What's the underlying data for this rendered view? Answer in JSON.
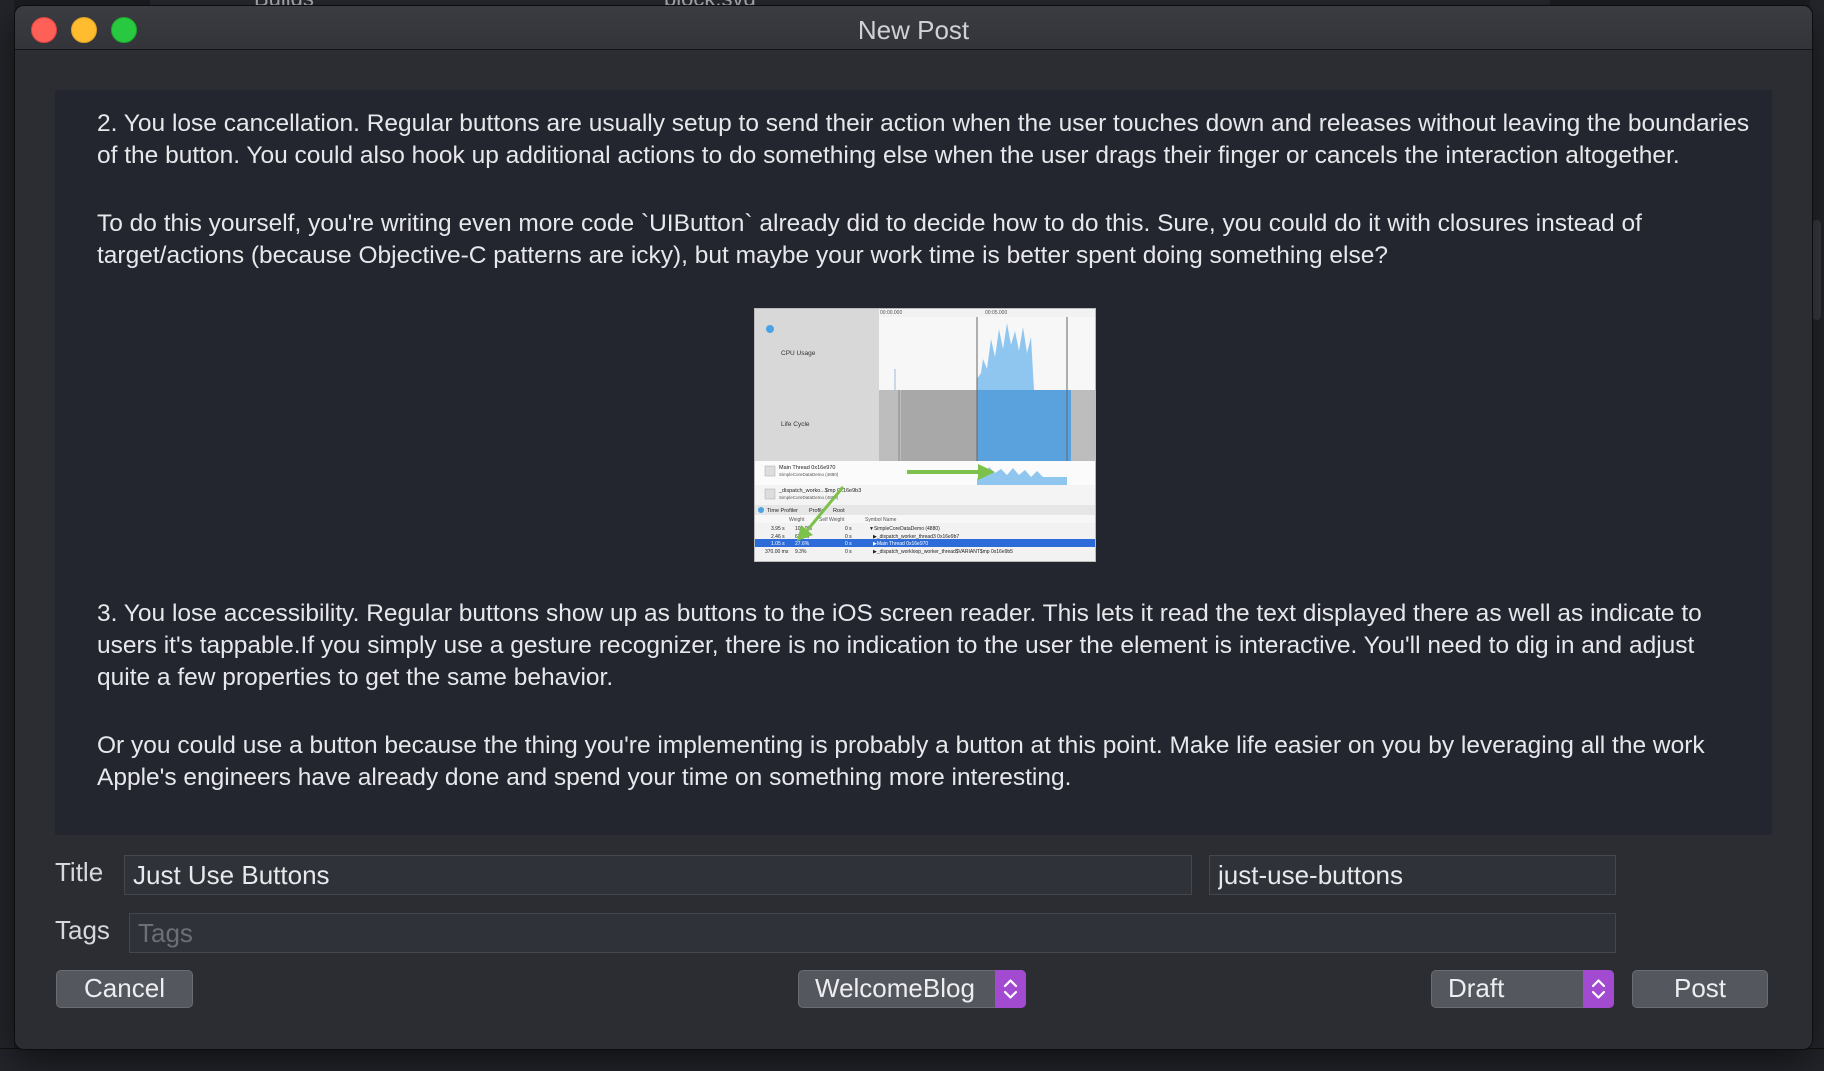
{
  "window": {
    "title": "New Post"
  },
  "background": {
    "ghost_texts": [
      "Builds",
      "block.svg"
    ]
  },
  "editor": {
    "paragraphs": [
      "2. You lose cancellation. Regular buttons are usually setup to send their action when the user touches down and releases without leaving the boundaries of the button. You could also hook up additional actions to do something else when the user drags their finger or cancels the interaction altogether.",
      "To do this yourself, you're writing even more code `UIButton` already did to decide how to do this. Sure, you could do it with closures instead of target/actions (because Objective-C patterns are icky), but maybe your work time is better spent doing something else?",
      "3. You lose accessibility. Regular buttons show up as buttons to the iOS screen reader. This lets it read the text displayed there as well as indicate to users it's tappable.If you simply use a gesture recognizer, there is no indication to the user the element is interactive. You'll need to dig in and adjust quite a few properties to get the same behavior.",
      "Or you could use a button because the thing you're implementing is probably a button at this point. Make life easier on you by leveraging all the work Apple's engineers have already done and spend your time on something more interesting."
    ],
    "figure": {
      "labels": {
        "cpu_usage": "CPU Usage",
        "life_cycle": "Life Cycle",
        "main_thread": "Main Thread 0x16e970",
        "main_thread_sub": "SimpleCoreDataDemo (4880)",
        "dispatch_worker": "_dispatch_worko...$mp 0x16e9b3",
        "dispatch_worker_sub": "SimpleCoreDataDemo (4880)",
        "time_profiler": "Time Profiler",
        "profile": "Profile",
        "root": "Root",
        "col_weight": "Weight",
        "col_self_weight": "Self Weight",
        "col_symbol": "Symbol Name",
        "time_start": "00:00.000",
        "time_mid": "00:05.000"
      },
      "rows": [
        {
          "weight": "3.95 s",
          "pct": "100.0%",
          "self": "0 s",
          "symbol": "▼SimpleCoreDataDemo (4880)"
        },
        {
          "weight": "2.46 s",
          "pct": "62.3%",
          "self": "0 s",
          "symbol": "▶_dispatch_worker_thread3 0x16e9b7"
        },
        {
          "weight": "1.05 s",
          "pct": "27.6%",
          "self": "0 s",
          "symbol": "▶Main Thread 0x16e970"
        },
        {
          "weight": "370.00 ms",
          "pct": "9.3%",
          "self": "0 s",
          "symbol": "▶_dispatch_workloop_worker_thread$VARIANT$mp 0x16e9b5"
        }
      ],
      "colors": {
        "accent_blue": "#4aa3e6",
        "selection_blue": "#2d6bd9",
        "arrow_green": "#7cc24a"
      }
    }
  },
  "form": {
    "title_label": "Title",
    "title_value": "Just Use Buttons",
    "slug_value": "just-use-buttons",
    "tags_label": "Tags",
    "tags_placeholder": "Tags",
    "tags_value": ""
  },
  "footer": {
    "cancel_label": "Cancel",
    "blog_selected": "WelcomeBlog",
    "status_selected": "Draft",
    "post_label": "Post",
    "accent_color": "#a24bd1"
  }
}
